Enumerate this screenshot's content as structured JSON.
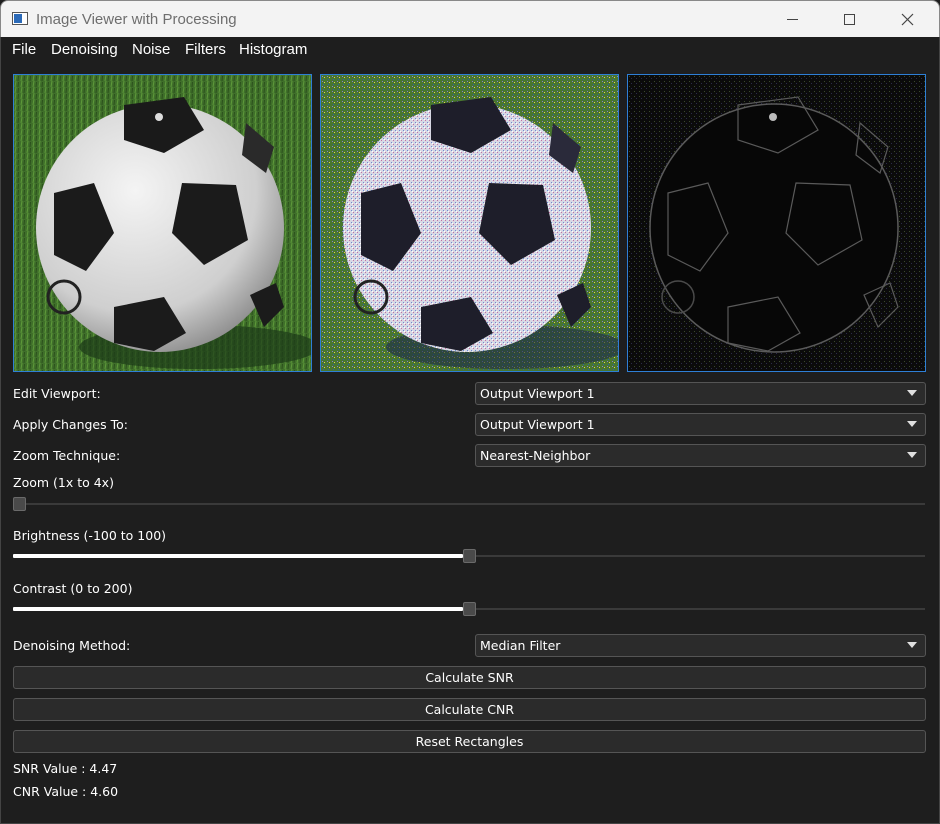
{
  "window": {
    "title": "Image Viewer with Processing"
  },
  "menu": [
    "File",
    "Denoising",
    "Noise",
    "Filters",
    "Histogram"
  ],
  "viewports": [
    "Input viewport",
    "Output Viewport 1",
    "Output Viewport 2"
  ],
  "controls": {
    "edit_viewport": {
      "label": "Edit Viewport:",
      "value": "Output Viewport 1"
    },
    "apply_changes": {
      "label": "Apply Changes To:",
      "value": "Output Viewport 1"
    },
    "zoom_technique": {
      "label": "Zoom Technique:",
      "value": "Nearest-Neighbor"
    },
    "zoom": {
      "label": "Zoom (1x to 4x)",
      "level": 0.0
    },
    "brightness": {
      "label": "Brightness (-100 to 100)",
      "level": 0.5
    },
    "contrast": {
      "label": "Contrast (0 to 200)",
      "level": 0.5
    },
    "denoising": {
      "label": "Denoising Method:",
      "value": "Median Filter"
    }
  },
  "buttons": {
    "snr": "Calculate SNR",
    "cnr": "Calculate CNR",
    "reset": "Reset Rectangles"
  },
  "results": {
    "snr": "SNR Value : 4.47",
    "cnr": "CNR Value : 4.60"
  },
  "colors": {
    "accent": "#2e7fd6",
    "grass": "#3f6f2a",
    "background": "#1e1e1e"
  }
}
